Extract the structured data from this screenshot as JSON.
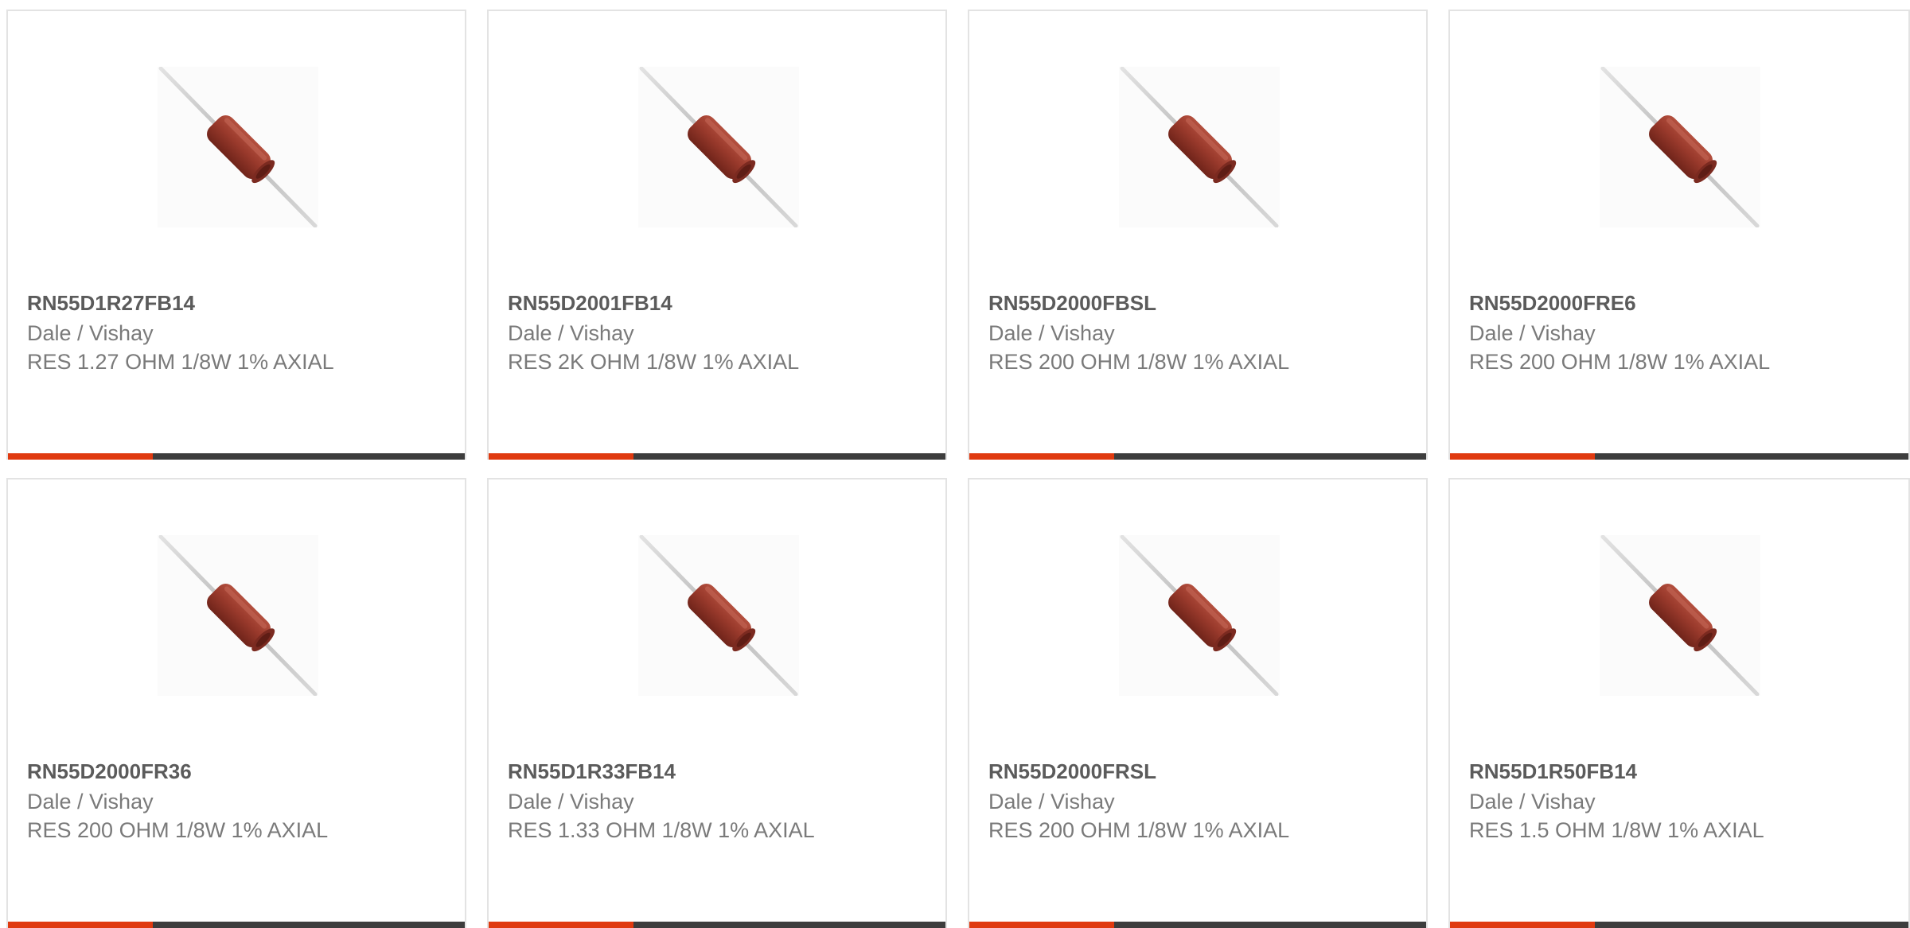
{
  "colors": {
    "accent": "#e03a10",
    "bar": "#3d3d3d",
    "part_number_text": "#5b5b5b",
    "secondary_text": "#7a7a7a",
    "card_border": "#e3e3e3"
  },
  "products": [
    {
      "part_number": "RN55D1R27FB14",
      "manufacturer": "Dale / Vishay",
      "description": "RES 1.27 OHM 1/8W 1% AXIAL",
      "image_icon": "axial-resistor-icon"
    },
    {
      "part_number": "RN55D2001FB14",
      "manufacturer": "Dale / Vishay",
      "description": "RES 2K OHM 1/8W 1% AXIAL",
      "image_icon": "axial-resistor-icon"
    },
    {
      "part_number": "RN55D2000FBSL",
      "manufacturer": "Dale / Vishay",
      "description": "RES 200 OHM 1/8W 1% AXIAL",
      "image_icon": "axial-resistor-icon"
    },
    {
      "part_number": "RN55D2000FRE6",
      "manufacturer": "Dale / Vishay",
      "description": "RES 200 OHM 1/8W 1% AXIAL",
      "image_icon": "axial-resistor-icon"
    },
    {
      "part_number": "RN55D2000FR36",
      "manufacturer": "Dale / Vishay",
      "description": "RES 200 OHM 1/8W 1% AXIAL",
      "image_icon": "axial-resistor-icon"
    },
    {
      "part_number": "RN55D1R33FB14",
      "manufacturer": "Dale / Vishay",
      "description": "RES 1.33 OHM 1/8W 1% AXIAL",
      "image_icon": "axial-resistor-icon"
    },
    {
      "part_number": "RN55D2000FRSL",
      "manufacturer": "Dale / Vishay",
      "description": "RES 200 OHM 1/8W 1% AXIAL",
      "image_icon": "axial-resistor-icon"
    },
    {
      "part_number": "RN55D1R50FB14",
      "manufacturer": "Dale / Vishay",
      "description": "RES 1.5 OHM 1/8W 1% AXIAL",
      "image_icon": "axial-resistor-icon"
    }
  ]
}
